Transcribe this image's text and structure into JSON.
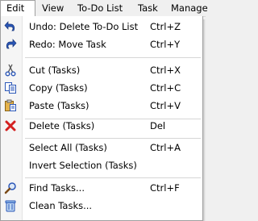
{
  "menubar": {
    "items": [
      {
        "label": "Edit"
      },
      {
        "label": "View"
      },
      {
        "label": "To-Do List"
      },
      {
        "label": "Task"
      },
      {
        "label": "Manage"
      }
    ]
  },
  "edit_menu": {
    "undo": {
      "label": "Undo: Delete To-Do List",
      "shortcut": "Ctrl+Z",
      "icon": "undo-icon"
    },
    "redo": {
      "label": "Redo: Move Task",
      "shortcut": "Ctrl+Y",
      "icon": "redo-icon"
    },
    "cut": {
      "label": "Cut (Tasks)",
      "shortcut": "Ctrl+X",
      "icon": "scissors-icon"
    },
    "copy": {
      "label": "Copy (Tasks)",
      "shortcut": "Ctrl+C",
      "icon": "copy-icon"
    },
    "paste": {
      "label": "Paste (Tasks)",
      "shortcut": "Ctrl+V",
      "icon": "clipboard-icon"
    },
    "delete": {
      "label": "Delete (Tasks)",
      "shortcut": "Del",
      "icon": "red-x-icon"
    },
    "select_all": {
      "label": "Select All (Tasks)",
      "shortcut": "Ctrl+A"
    },
    "invert_selection": {
      "label": "Invert Selection (Tasks)"
    },
    "find": {
      "label": "Find Tasks...",
      "shortcut": "Ctrl+F",
      "icon": "magnifier-icon"
    },
    "clean": {
      "label": "Clean Tasks...",
      "icon": "trash-can-icon"
    }
  },
  "colors": {
    "menu_background": "#ffffff",
    "gutter": "#f5f5f5",
    "delete_icon": "#d42020"
  }
}
